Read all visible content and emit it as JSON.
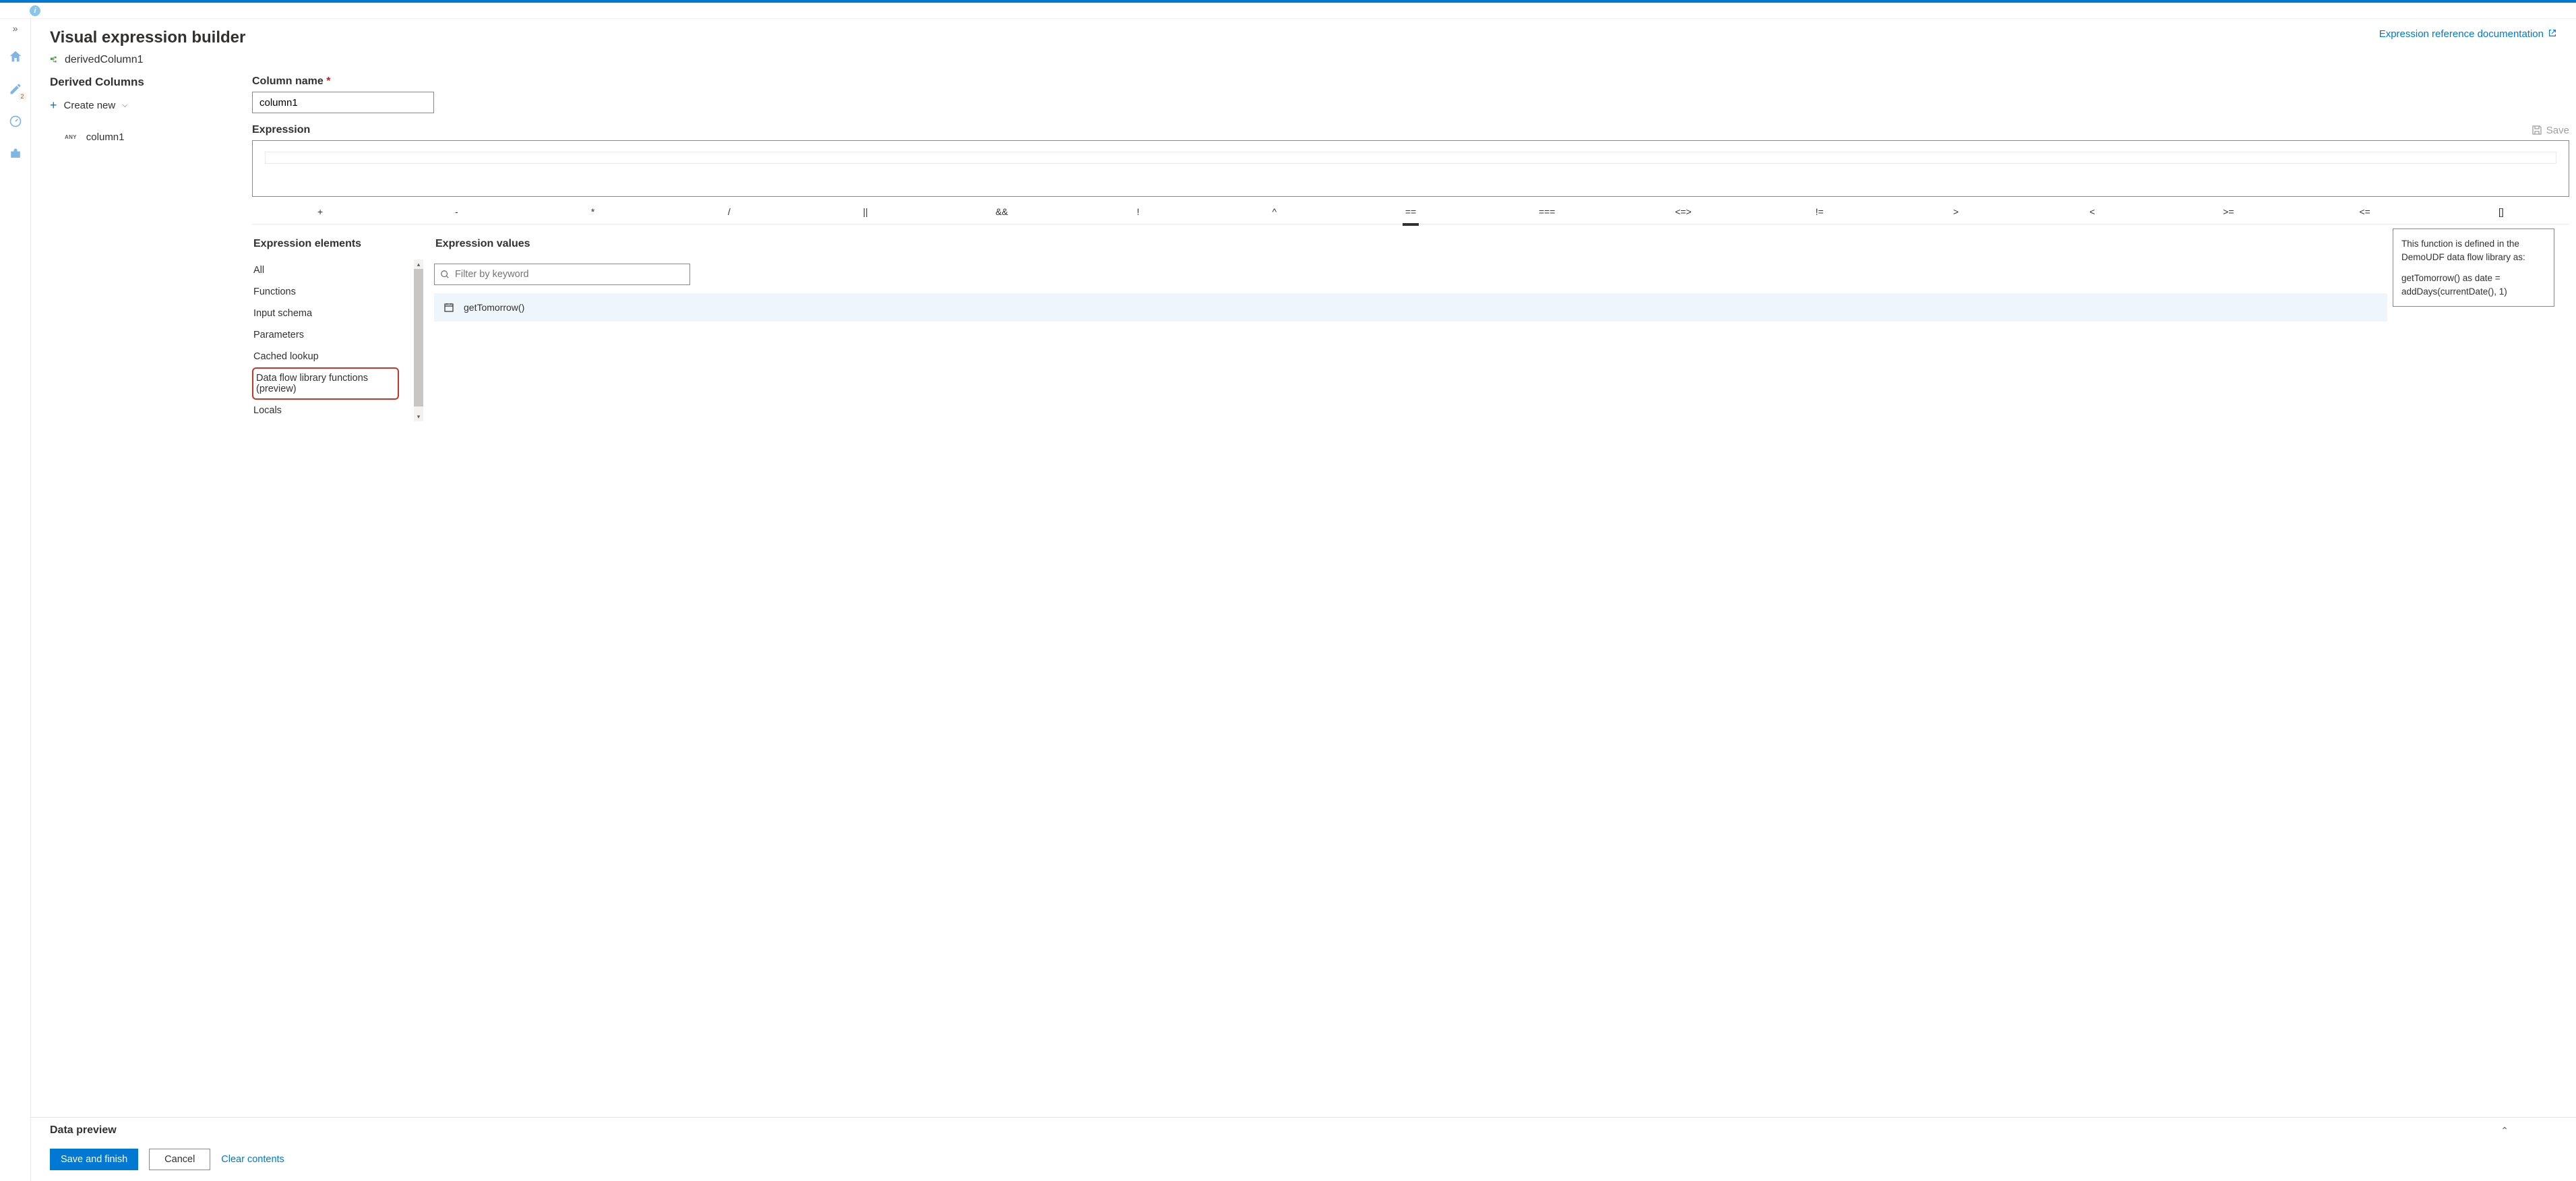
{
  "header": {
    "title": "Visual expression builder",
    "node_name": "derivedColumn1",
    "doc_link": "Expression reference documentation"
  },
  "left_rail": {
    "badge_count": "2"
  },
  "derived": {
    "title": "Derived Columns",
    "create_label": "Create new",
    "item_type": "ANY",
    "item_name": "column1"
  },
  "form": {
    "col_name_label": "Column name",
    "col_name_value": "column1",
    "expr_label": "Expression",
    "save": "Save"
  },
  "operators": [
    "+",
    "-",
    "*",
    "/",
    "||",
    "&&",
    "!",
    "^",
    "==",
    "===",
    "<=>",
    "!=",
    ">",
    "<",
    ">=",
    "<=",
    "[]"
  ],
  "elements": {
    "title": "Expression elements",
    "items": [
      "All",
      "Functions",
      "Input schema",
      "Parameters",
      "Cached lookup",
      "Data flow library functions (preview)",
      "Locals"
    ],
    "highlight_index": 5
  },
  "values": {
    "title": "Expression values",
    "filter_placeholder": "Filter by keyword",
    "item": "getTomorrow()",
    "tooltip_top": "This function is defined in the DemoUDF data flow library as:",
    "tooltip_code1": "getTomorrow() as date =",
    "tooltip_code2": "addDays(currentDate(), 1)"
  },
  "preview": {
    "title": "Data preview"
  },
  "footer": {
    "save": "Save and finish",
    "cancel": "Cancel",
    "clear": "Clear contents"
  }
}
